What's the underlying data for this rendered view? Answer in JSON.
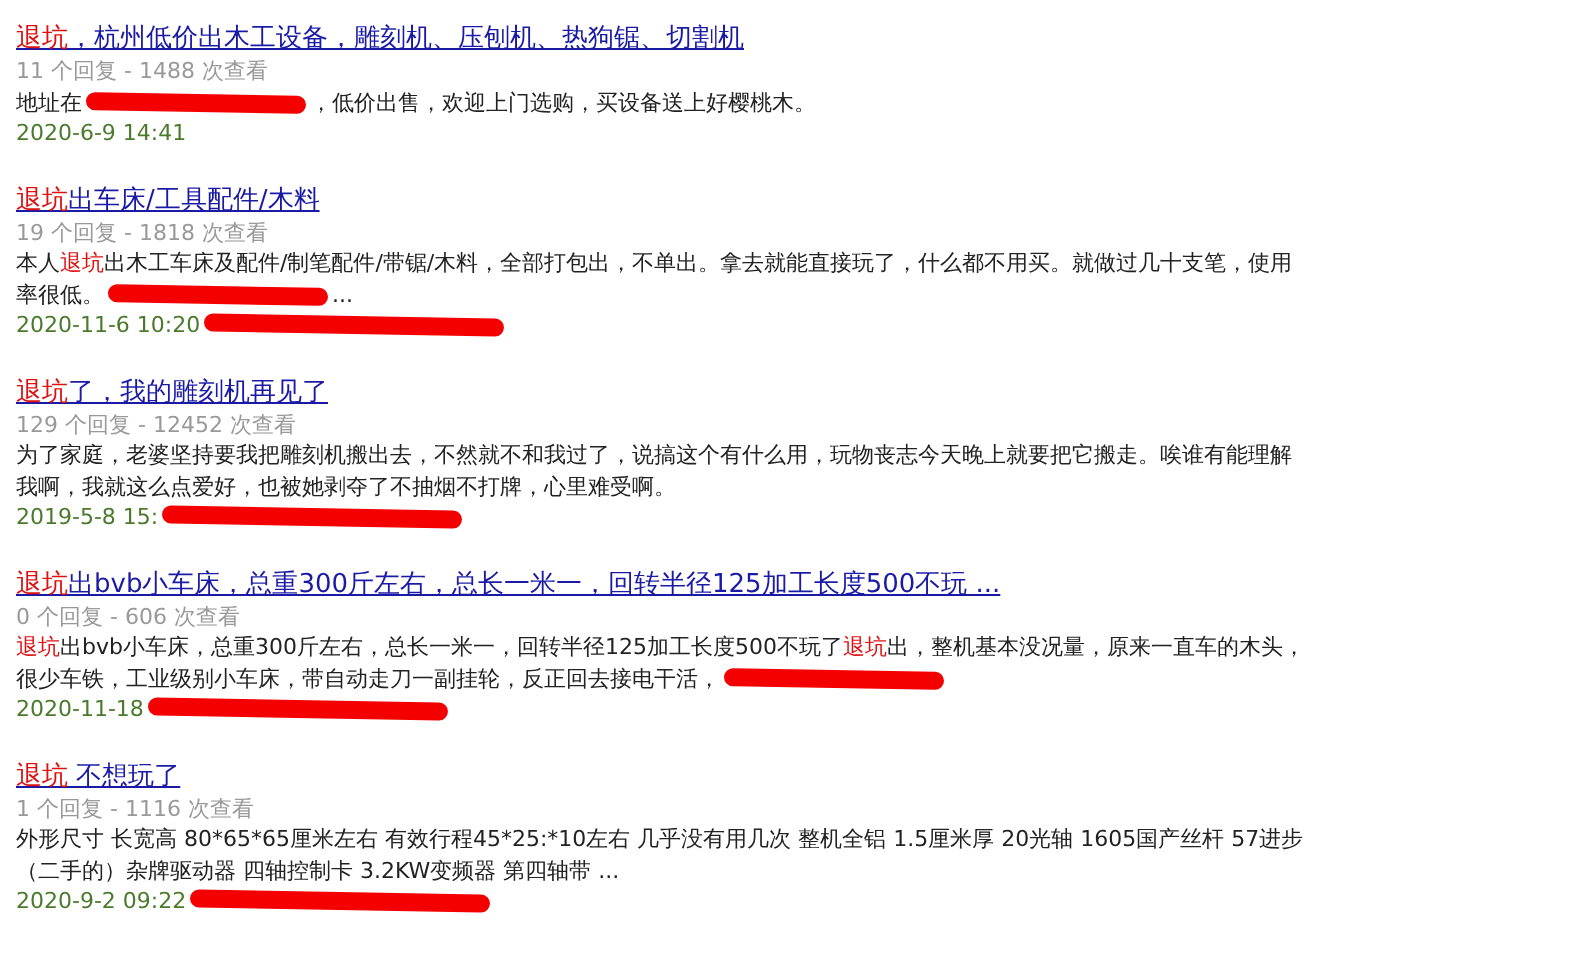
{
  "results": [
    {
      "title": [
        {
          "text": "退坑",
          "hl": true
        },
        {
          "text": "，杭州低价出木工设备，雕刻机、压刨机、热狗锯、切割机",
          "hl": false
        }
      ],
      "stats": "11 个回复 - 1488 次查看",
      "lines": [
        [
          {
            "kind": "text",
            "runs": [
              {
                "text": "地址在",
                "hl": false
              }
            ]
          },
          {
            "kind": "redaction"
          },
          {
            "kind": "text",
            "runs": [
              {
                "text": "，低价出售，欢迎上门选购，买设备送上好樱桃木。",
                "hl": false
              }
            ]
          }
        ]
      ],
      "date": "2020-6-9 14:41",
      "date_redaction": false
    },
    {
      "title": [
        {
          "text": "退坑",
          "hl": true
        },
        {
          "text": "出车床/工具配件/木料",
          "hl": false
        }
      ],
      "stats": "19 个回复 - 1818 次查看",
      "lines": [
        [
          {
            "kind": "text",
            "runs": [
              {
                "text": "本人",
                "hl": false
              },
              {
                "text": "退坑",
                "hl": true
              },
              {
                "text": "出木工车床及配件/制笔配件/带锯/木料，全部打包出，不单出。拿去就能直接玩了，什么都不用买。就做过几十支笔，使用",
                "hl": false
              }
            ]
          }
        ],
        [
          {
            "kind": "text",
            "runs": [
              {
                "text": "率很低。",
                "hl": false
              }
            ]
          },
          {
            "kind": "redaction"
          },
          {
            "kind": "text",
            "runs": [
              {
                "text": "...",
                "hl": false
              }
            ]
          }
        ]
      ],
      "date": "2020-11-6 10:20",
      "date_redaction": true
    },
    {
      "title": [
        {
          "text": "退坑",
          "hl": true
        },
        {
          "text": "了，我的雕刻机再见了",
          "hl": false
        }
      ],
      "stats": "129 个回复 - 12452 次查看",
      "lines": [
        [
          {
            "kind": "text",
            "runs": [
              {
                "text": "为了家庭，老婆坚持要我把雕刻机搬出去，不然就不和我过了，说搞这个有什么用，玩物丧志今天晚上就要把它搬走。唉谁有能理解",
                "hl": false
              }
            ]
          }
        ],
        [
          {
            "kind": "text",
            "runs": [
              {
                "text": "我啊，我就这么点爱好，也被她剥夺了不抽烟不打牌，心里难受啊。",
                "hl": false
              }
            ]
          }
        ]
      ],
      "date": "2019-5-8 15:",
      "date_redaction": true
    },
    {
      "title": [
        {
          "text": "退坑",
          "hl": true
        },
        {
          "text": "出bvb小车床，总重300斤左右，总长一米一，回转半径125加工长度500不玩 ...",
          "hl": false
        }
      ],
      "stats": "0 个回复 - 606 次查看",
      "lines": [
        [
          {
            "kind": "text",
            "runs": [
              {
                "text": "退坑",
                "hl": true
              },
              {
                "text": "出bvb小车床，总重300斤左右，总长一米一，回转半径125加工长度500不玩了",
                "hl": false
              },
              {
                "text": "退坑",
                "hl": true
              },
              {
                "text": "出，整机基本没况量，原来一直车的木头，",
                "hl": false
              }
            ]
          }
        ],
        [
          {
            "kind": "text",
            "runs": [
              {
                "text": "很少车铁，工业级别小车床，带自动走刀一副挂轮，反正回去接电干活，",
                "hl": false
              }
            ]
          },
          {
            "kind": "redaction"
          }
        ]
      ],
      "date": "2020-11-18",
      "date_redaction": true
    },
    {
      "title": [
        {
          "text": "退坑",
          "hl": true
        },
        {
          "text": " 不想玩了",
          "hl": false
        }
      ],
      "stats": "1 个回复 - 1116 次查看",
      "lines": [
        [
          {
            "kind": "text",
            "runs": [
              {
                "text": "外形尺寸 长宽高 80*65*65厘米左右 有效行程45*25:*10左右 几乎没有用几次 整机全铝 1.5厘米厚 20光轴 1605国产丝杆 57进步",
                "hl": false
              }
            ]
          }
        ],
        [
          {
            "kind": "text",
            "runs": [
              {
                "text": "（二手的）杂牌驱动器 四轴控制卡 3.2KW变频器 第四轴带 ...",
                "hl": false
              }
            ]
          }
        ]
      ],
      "date": "2020-9-2 09:22",
      "date_redaction": true
    }
  ]
}
